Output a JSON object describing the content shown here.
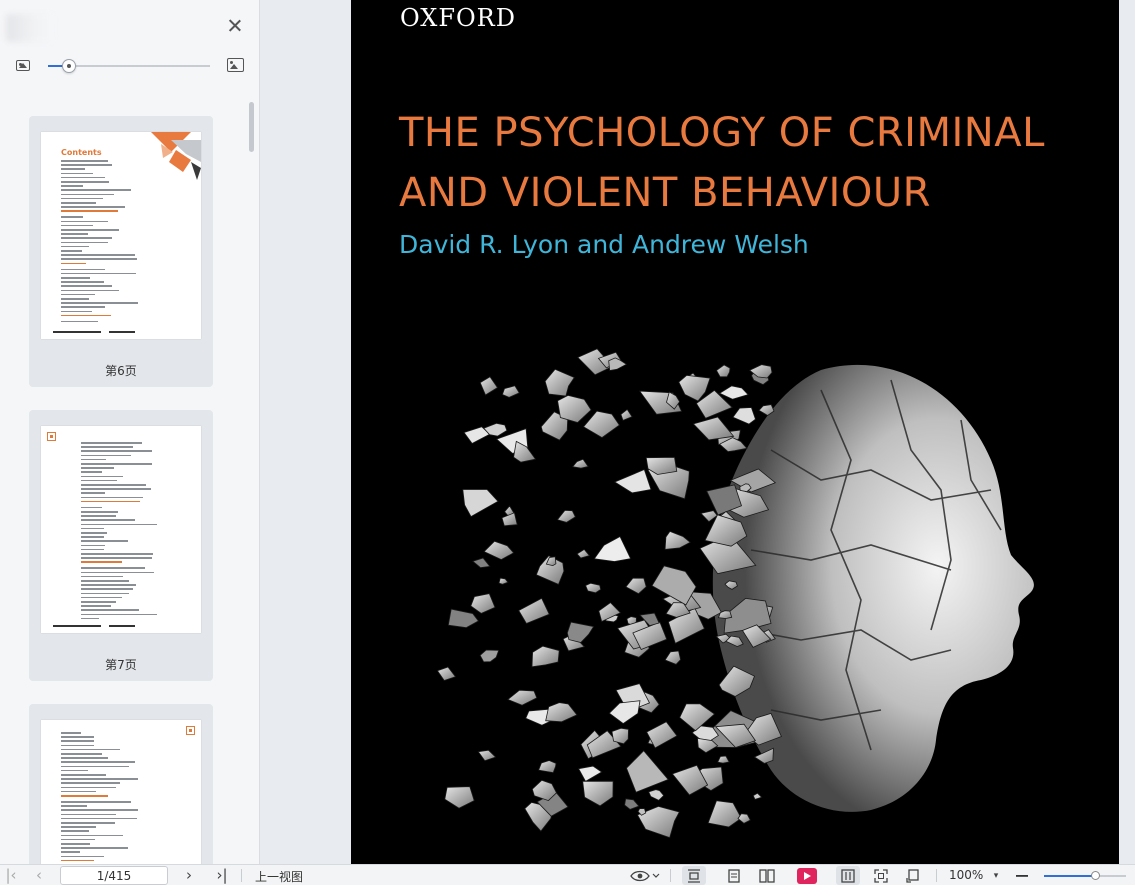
{
  "sidebar": {
    "thumbnail_size_fraction": 0.13,
    "thumbnails": [
      {
        "label": "第6页",
        "heading": "Contents"
      },
      {
        "label": "第7页",
        "heading": ""
      },
      {
        "label": "",
        "heading": ""
      }
    ]
  },
  "cover": {
    "publisher": "OXFORD",
    "title_line_1": "THE PSYCHOLOGY OF CRIMINAL",
    "title_line_2": "AND VIOLENT BEHAVIOUR",
    "authors": "David R. Lyon and Andrew Welsh",
    "colors": {
      "title": "#e8793f",
      "authors": "#3fb6d9",
      "background": "#000000"
    }
  },
  "statusbar": {
    "page_value": "1/415",
    "prev_view_label": "上一视图",
    "zoom_label": "100%",
    "zoom_fraction": 0.62,
    "icons": [
      "first-page-icon",
      "prev-page-icon",
      "next-page-icon",
      "last-page-icon",
      "eye-icon",
      "fit-width-icon",
      "single-page-icon",
      "dual-page-icon",
      "play-icon",
      "continuous-icon",
      "fullscreen-icon",
      "rotate-icon",
      "zoom-out-icon"
    ]
  }
}
